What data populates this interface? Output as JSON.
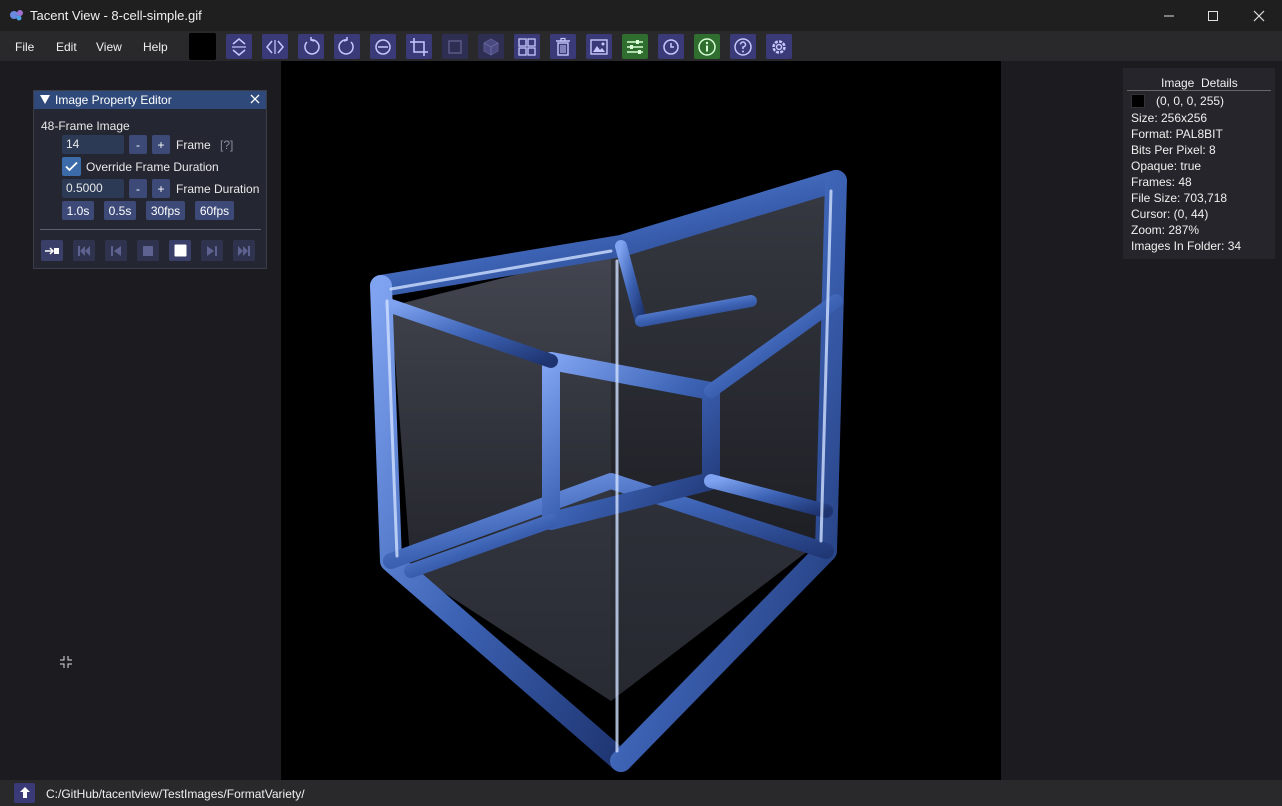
{
  "window": {
    "title": "Tacent View - 8-cell-simple.gif"
  },
  "menu": {
    "items": [
      "File",
      "Edit",
      "View",
      "Help"
    ]
  },
  "toolbar": {
    "color_swatch": "#000000",
    "buttons": [
      {
        "name": "flip-vertical-icon",
        "enabled": true
      },
      {
        "name": "flip-horizontal-icon",
        "enabled": true
      },
      {
        "name": "rotate-ccw-icon",
        "enabled": true
      },
      {
        "name": "rotate-cw-icon",
        "enabled": true
      },
      {
        "name": "rotate-theta-icon",
        "enabled": true
      },
      {
        "name": "crop-icon",
        "enabled": true
      },
      {
        "name": "tile-icon",
        "enabled": false
      },
      {
        "name": "cube-icon",
        "enabled": false
      },
      {
        "name": "thumbnail-grid-icon",
        "enabled": true
      },
      {
        "name": "trash-icon",
        "enabled": true
      },
      {
        "name": "save-image-icon",
        "enabled": true
      },
      {
        "name": "property-editor-icon",
        "enabled": true,
        "active": true
      },
      {
        "name": "refresh-icon",
        "enabled": true
      },
      {
        "name": "info-icon",
        "enabled": true,
        "active": true
      },
      {
        "name": "help-icon",
        "enabled": true
      },
      {
        "name": "settings-gear-icon",
        "enabled": true
      }
    ]
  },
  "property_editor": {
    "title": "Image Property Editor",
    "image_type": "48-Frame Image",
    "frame_value": "14",
    "frame_label": "Frame",
    "frame_help": "[?]",
    "minus": "-",
    "plus": "+",
    "override_label": "Override Frame Duration",
    "override_checked": true,
    "duration_value": "0.5000",
    "duration_label": "Frame Duration",
    "presets": [
      "1.0s",
      "0.5s",
      "30fps",
      "60fps"
    ],
    "playback": [
      {
        "name": "loop-icon",
        "enabled": true
      },
      {
        "name": "skip-to-start-icon",
        "enabled": false
      },
      {
        "name": "step-back-icon",
        "enabled": false
      },
      {
        "name": "stop-icon",
        "enabled": false
      },
      {
        "name": "play-pause-icon",
        "enabled": true
      },
      {
        "name": "step-forward-icon",
        "enabled": false
      },
      {
        "name": "skip-to-end-icon",
        "enabled": false
      }
    ]
  },
  "details": {
    "header": "Image  Details",
    "pixel_color": "(0, 0, 0, 255)",
    "size": "Size: 256x256",
    "format": "Format: PAL8BIT",
    "bpp": "Bits Per Pixel: 8",
    "opaque": "Opaque: true",
    "frames": "Frames: 48",
    "file_size": "File Size: 703,718",
    "cursor": "Cursor: (0, 44)",
    "zoom": "Zoom: 287%",
    "images_in_folder": "Images In Folder: 34"
  },
  "status": {
    "path": "C:/GitHub/tacentview/TestImages/FormatVariety/"
  },
  "colors": {
    "accent": "#3a3a78",
    "active_green": "#2f6e2f",
    "panel_header": "#2f4a7a",
    "hypercube_blue": "#3d63b5"
  }
}
